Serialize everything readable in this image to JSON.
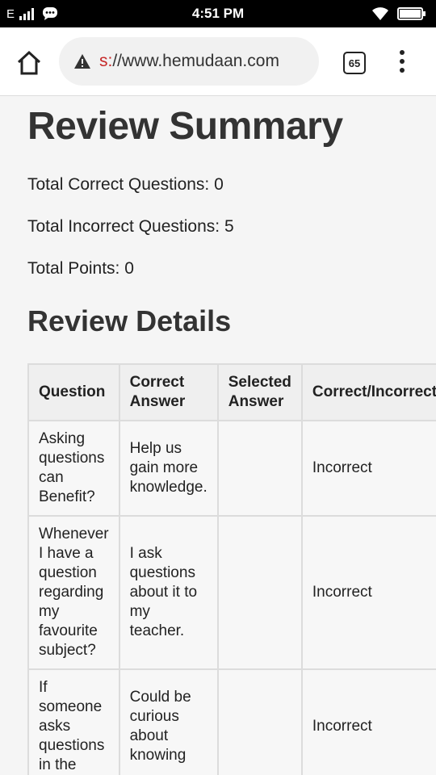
{
  "status_bar": {
    "network": "E",
    "time": "4:51 PM"
  },
  "browser": {
    "url_scheme": "s:",
    "url_rest": "//www.hemudaan.com",
    "tab_count": "65"
  },
  "page": {
    "title": "Review Summary",
    "stats": [
      "Total Correct Questions: 0",
      "Total Incorrect Questions: 5",
      "Total Points: 0"
    ],
    "details_heading": "Review Details",
    "table": {
      "headers": [
        "Question",
        "Correct Answer",
        "Selected Answer",
        "Correct/Incorrect"
      ],
      "rows": [
        {
          "question": "Asking questions can Benefit?",
          "correct": "Help us gain more knowledge.",
          "selected": "",
          "result": "Incorrect"
        },
        {
          "question": "Whenever I have a question regarding my favourite subject?",
          "correct": "I ask questions about it to my teacher.",
          "selected": "",
          "result": "Incorrect"
        },
        {
          "question": "If someone asks questions in the",
          "correct": "Could be curious about knowing",
          "selected": "",
          "result": "Incorrect"
        }
      ]
    }
  }
}
